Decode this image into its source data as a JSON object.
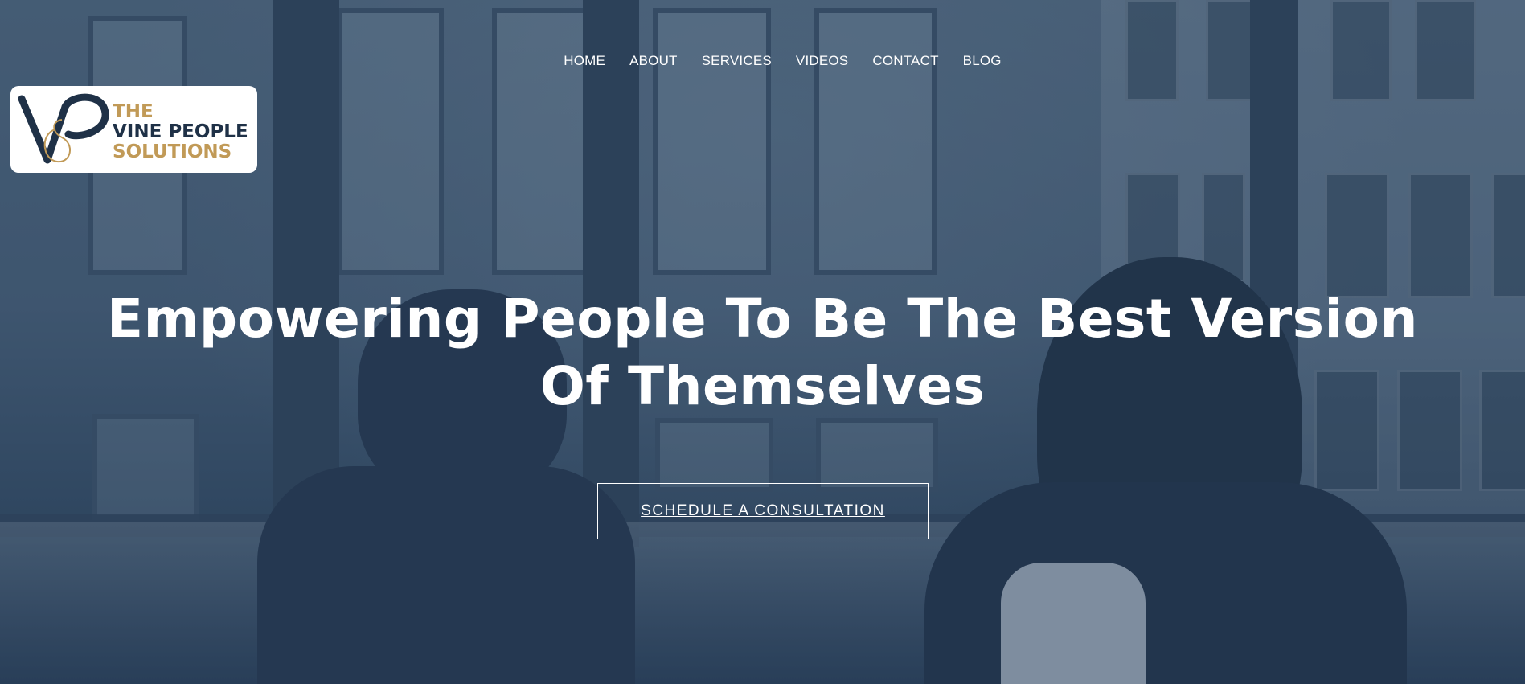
{
  "nav": {
    "items": [
      {
        "label": "HOME"
      },
      {
        "label": "ABOUT"
      },
      {
        "label": "SERVICES"
      },
      {
        "label": "VIDEOS"
      },
      {
        "label": "CONTACT"
      },
      {
        "label": "BLOG"
      }
    ]
  },
  "logo": {
    "line1": "THE",
    "line2": "VINE PEOPLE",
    "line3": "SOLUTIONS",
    "monogram": "VP",
    "colors": {
      "gold": "#c19a57",
      "navy": "#1f3147"
    }
  },
  "hero": {
    "headline": "Empowering People To Be The Best Version Of Themselves",
    "cta_label": "SCHEDULE A CONSULTATION",
    "overlay_color": "#3f5670"
  }
}
